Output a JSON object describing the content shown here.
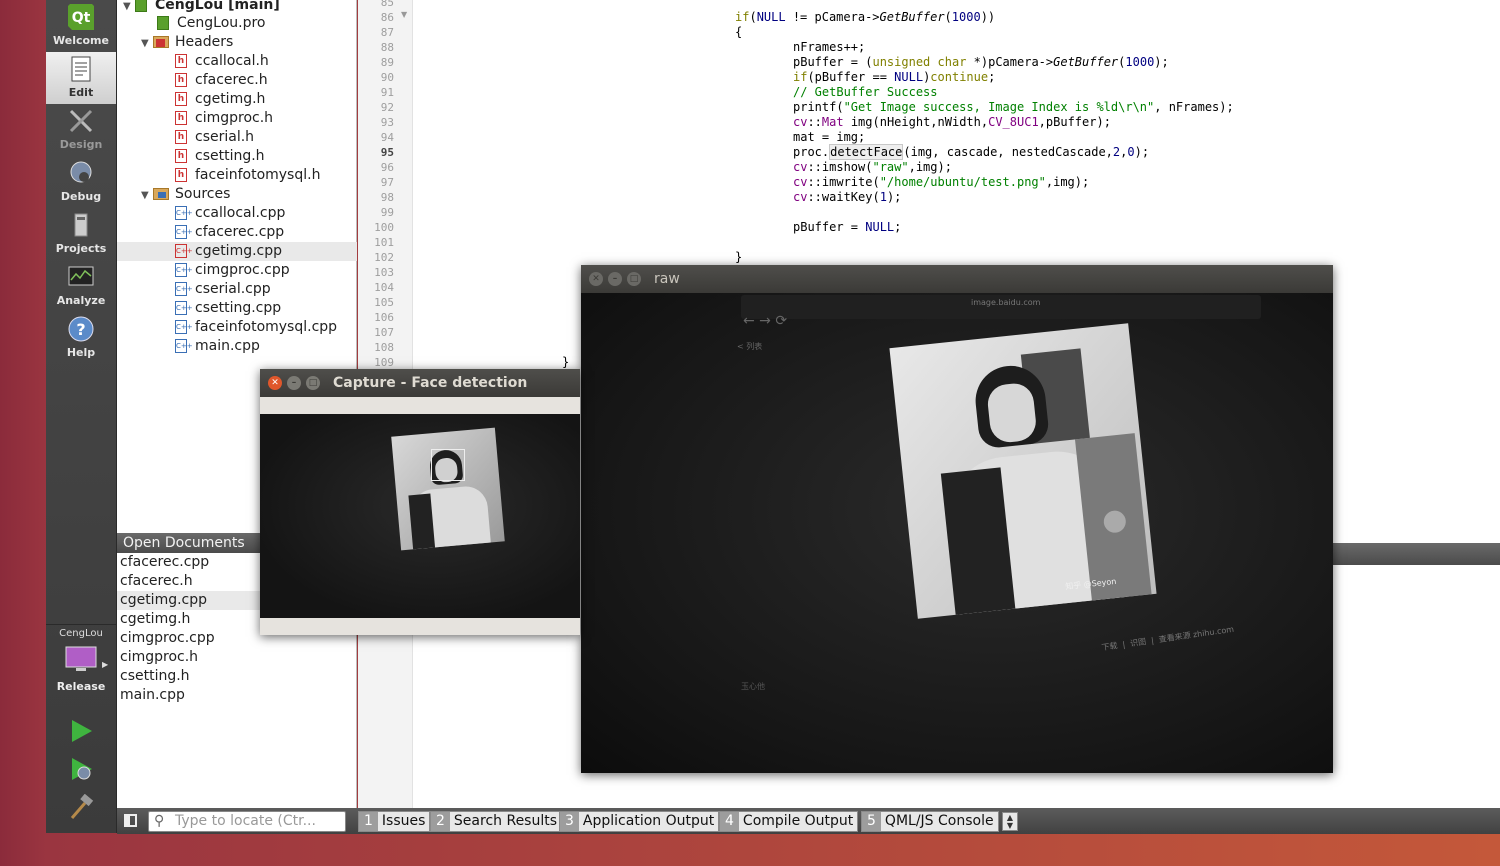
{
  "modebar": {
    "items": [
      {
        "label": "Welcome"
      },
      {
        "label": "Edit"
      },
      {
        "label": "Design"
      },
      {
        "label": "Debug"
      },
      {
        "label": "Projects"
      },
      {
        "label": "Analyze"
      },
      {
        "label": "Help"
      }
    ],
    "target_project": "CengLou",
    "build_config": "Release"
  },
  "project_tree": {
    "root": "CengLou [main]",
    "pro_file": "CengLou.pro",
    "headers_label": "Headers",
    "headers": [
      "ccallocal.h",
      "cfacerec.h",
      "cgetimg.h",
      "cimgproc.h",
      "cserial.h",
      "csetting.h",
      "faceinfotomysql.h"
    ],
    "sources_label": "Sources",
    "sources": [
      "ccallocal.cpp",
      "cfacerec.cpp",
      "cgetimg.cpp",
      "cimgproc.cpp",
      "cserial.cpp",
      "csetting.cpp",
      "faceinfotomysql.cpp",
      "main.cpp"
    ],
    "selected": "cgetimg.cpp"
  },
  "open_documents": {
    "title": "Open Documents",
    "items": [
      "cfacerec.cpp",
      "cfacerec.h",
      "cgetimg.cpp",
      "cgetimg.h",
      "cimgproc.cpp",
      "cimgproc.h",
      "csetting.h",
      "main.cpp"
    ],
    "selected": "cgetimg.cpp"
  },
  "editor": {
    "line_numbers": [
      "85",
      "86",
      "87",
      "88",
      "89",
      "90",
      "91",
      "92",
      "93",
      "94",
      "95",
      "96",
      "97",
      "98",
      "99",
      "100",
      "101",
      "102",
      "103",
      "104",
      "105",
      "106",
      "107",
      "108",
      "109"
    ],
    "current_line": "95"
  },
  "bottom": {
    "locate_placeholder": "Type to locate (Ctr...",
    "tabs": [
      {
        "num": "1",
        "label": "Issues"
      },
      {
        "num": "2",
        "label": "Search Results"
      },
      {
        "num": "3",
        "label": "Application Output"
      },
      {
        "num": "4",
        "label": "Compile Output"
      },
      {
        "num": "5",
        "label": "QML/JS Console"
      }
    ]
  },
  "windows": {
    "capture_title": "Capture - Face detection",
    "raw_title": "raw"
  },
  "photo_text": {
    "url": "image.baidu.com",
    "back_label": "< 列表",
    "watermark": "知乎 @Seyon",
    "actions": [
      "下载",
      "识图",
      "查看来源 zhihu.com"
    ],
    "bottom_left": "玉心他"
  },
  "colors": {
    "mode_bar": "#404040",
    "desktop": "#b84a3c",
    "keyword": "#808000",
    "type": "#800080",
    "string": "#008000",
    "number": "#000080"
  }
}
